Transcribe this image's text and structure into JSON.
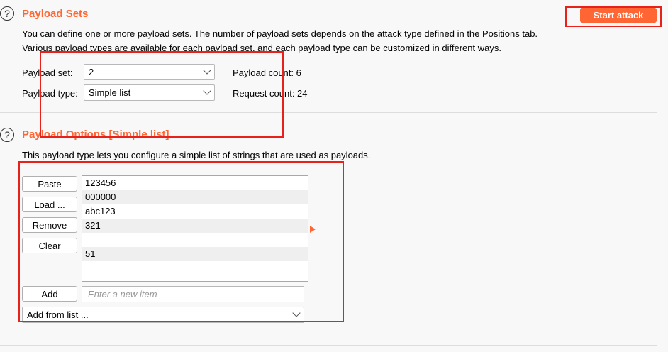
{
  "payload_sets": {
    "help_glyph": "?",
    "title": "Payload Sets",
    "start_attack": "Start attack",
    "desc_line1": "You can define one or more payload sets. The number of payload sets depends on the attack type defined in the Positions tab.",
    "desc_line2": "Various payload types are available for each payload set, and each payload type can be customized in different ways.",
    "payload_set_label": "Payload set:",
    "payload_set_value": "2",
    "payload_type_label": "Payload type:",
    "payload_type_value": "Simple list",
    "payload_count": "Payload count: 6",
    "request_count": "Request count: 24"
  },
  "payload_options": {
    "help_glyph": "?",
    "title": "Payload Options [Simple list]",
    "desc": "This payload type lets you configure a simple list of strings that are used as payloads.",
    "buttons": {
      "paste": "Paste",
      "load": "Load ...",
      "remove": "Remove",
      "clear": "Clear",
      "add": "Add"
    },
    "items": [
      "123456",
      "000000",
      "abc123",
      "321",
      "",
      "51"
    ],
    "new_item_placeholder": "Enter a new item",
    "add_from_list": "Add from list ..."
  },
  "colors": {
    "accent": "#ff6633",
    "highlight": "#e8221b"
  },
  "icons": [
    "help-icon",
    "chevron-down-icon",
    "arrow-right-icon"
  ]
}
